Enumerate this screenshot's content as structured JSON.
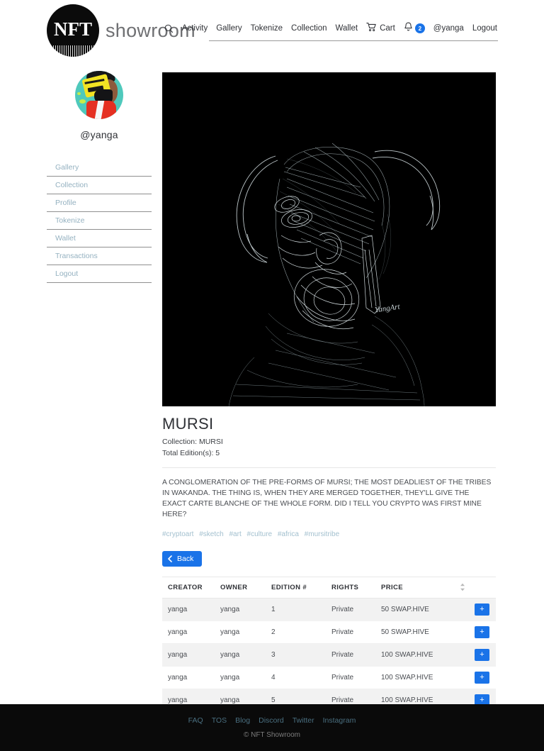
{
  "header": {
    "logo_text": "NFT",
    "brand_word": "showroom",
    "nav": [
      {
        "type": "icon",
        "icon": "search-icon",
        "label": ""
      },
      {
        "type": "link",
        "label": "Activity"
      },
      {
        "type": "link",
        "label": "Gallery"
      },
      {
        "type": "link",
        "label": "Tokenize"
      },
      {
        "type": "link",
        "label": "Collection"
      },
      {
        "type": "link",
        "label": "Wallet"
      },
      {
        "type": "icon-link",
        "icon": "cart-icon",
        "label": "Cart"
      },
      {
        "type": "icon-badge",
        "icon": "bell-icon",
        "badge": "2"
      },
      {
        "type": "link",
        "label": "@yanga"
      },
      {
        "type": "link",
        "label": "Logout"
      }
    ],
    "cart_label": "Cart",
    "notification_count": "2",
    "user_handle": "@yanga",
    "logout_label": "Logout"
  },
  "sidebar": {
    "handle": "@yanga",
    "avatar_alt": "yanga-avatar",
    "items": [
      {
        "label": "Gallery"
      },
      {
        "label": "Collection"
      },
      {
        "label": "Profile"
      },
      {
        "label": "Tokenize"
      },
      {
        "label": "Wallet"
      },
      {
        "label": "Transactions"
      },
      {
        "label": "Logout"
      }
    ]
  },
  "artwork": {
    "alt": "MURSI line art sketch of horned figure on black background",
    "signature": "YangArt",
    "background_color": "#000000",
    "line_color": "#e8f0f2"
  },
  "detail": {
    "title": "MURSI",
    "collection_line": "Collection: MURSI",
    "editions_line": "Total Edition(s): 5",
    "description": "A CONGLOMERATION OF THE PRE-FORMS OF MURSI; THE MOST DEADLIEST OF THE TRIBES IN WAKANDA. THE THING IS, WHEN THEY ARE MERGED TOGETHER, THEY'LL GIVE THE EXACT CARTE BLANCHE OF THE WHOLE FORM. DID I TELL YOU CRYPTO WAS FIRST MINE HERE?",
    "tags": [
      "#cryptoart",
      "#sketch",
      "#art",
      "#culture",
      "#africa",
      "#mursitribe"
    ],
    "back_label": "Back"
  },
  "table": {
    "columns": [
      "CREATOR",
      "OWNER",
      "EDITION #",
      "RIGHTS",
      "PRICE"
    ],
    "sort_icon": "sort-updown-icon",
    "add_label": "+",
    "rows": [
      {
        "creator": "yanga",
        "owner": "yanga",
        "edition": "1",
        "rights": "Private",
        "price": "50 SWAP.HIVE"
      },
      {
        "creator": "yanga",
        "owner": "yanga",
        "edition": "2",
        "rights": "Private",
        "price": "50 SWAP.HIVE"
      },
      {
        "creator": "yanga",
        "owner": "yanga",
        "edition": "3",
        "rights": "Private",
        "price": "100 SWAP.HIVE"
      },
      {
        "creator": "yanga",
        "owner": "yanga",
        "edition": "4",
        "rights": "Private",
        "price": "100 SWAP.HIVE"
      },
      {
        "creator": "yanga",
        "owner": "yanga",
        "edition": "5",
        "rights": "Private",
        "price": "100 SWAP.HIVE"
      }
    ]
  },
  "footer": {
    "links": [
      "FAQ",
      "TOS",
      "Blog",
      "Discord",
      "Twitter",
      "Instagram"
    ],
    "copyright": "© NFT Showroom"
  },
  "colors": {
    "accent_blue": "#1a73e8",
    "tag_blue": "#a3c0cf",
    "sidebar_link": "#94b1c0",
    "footer_bg": "#0a0a0a",
    "footer_link": "#4a6f80"
  }
}
